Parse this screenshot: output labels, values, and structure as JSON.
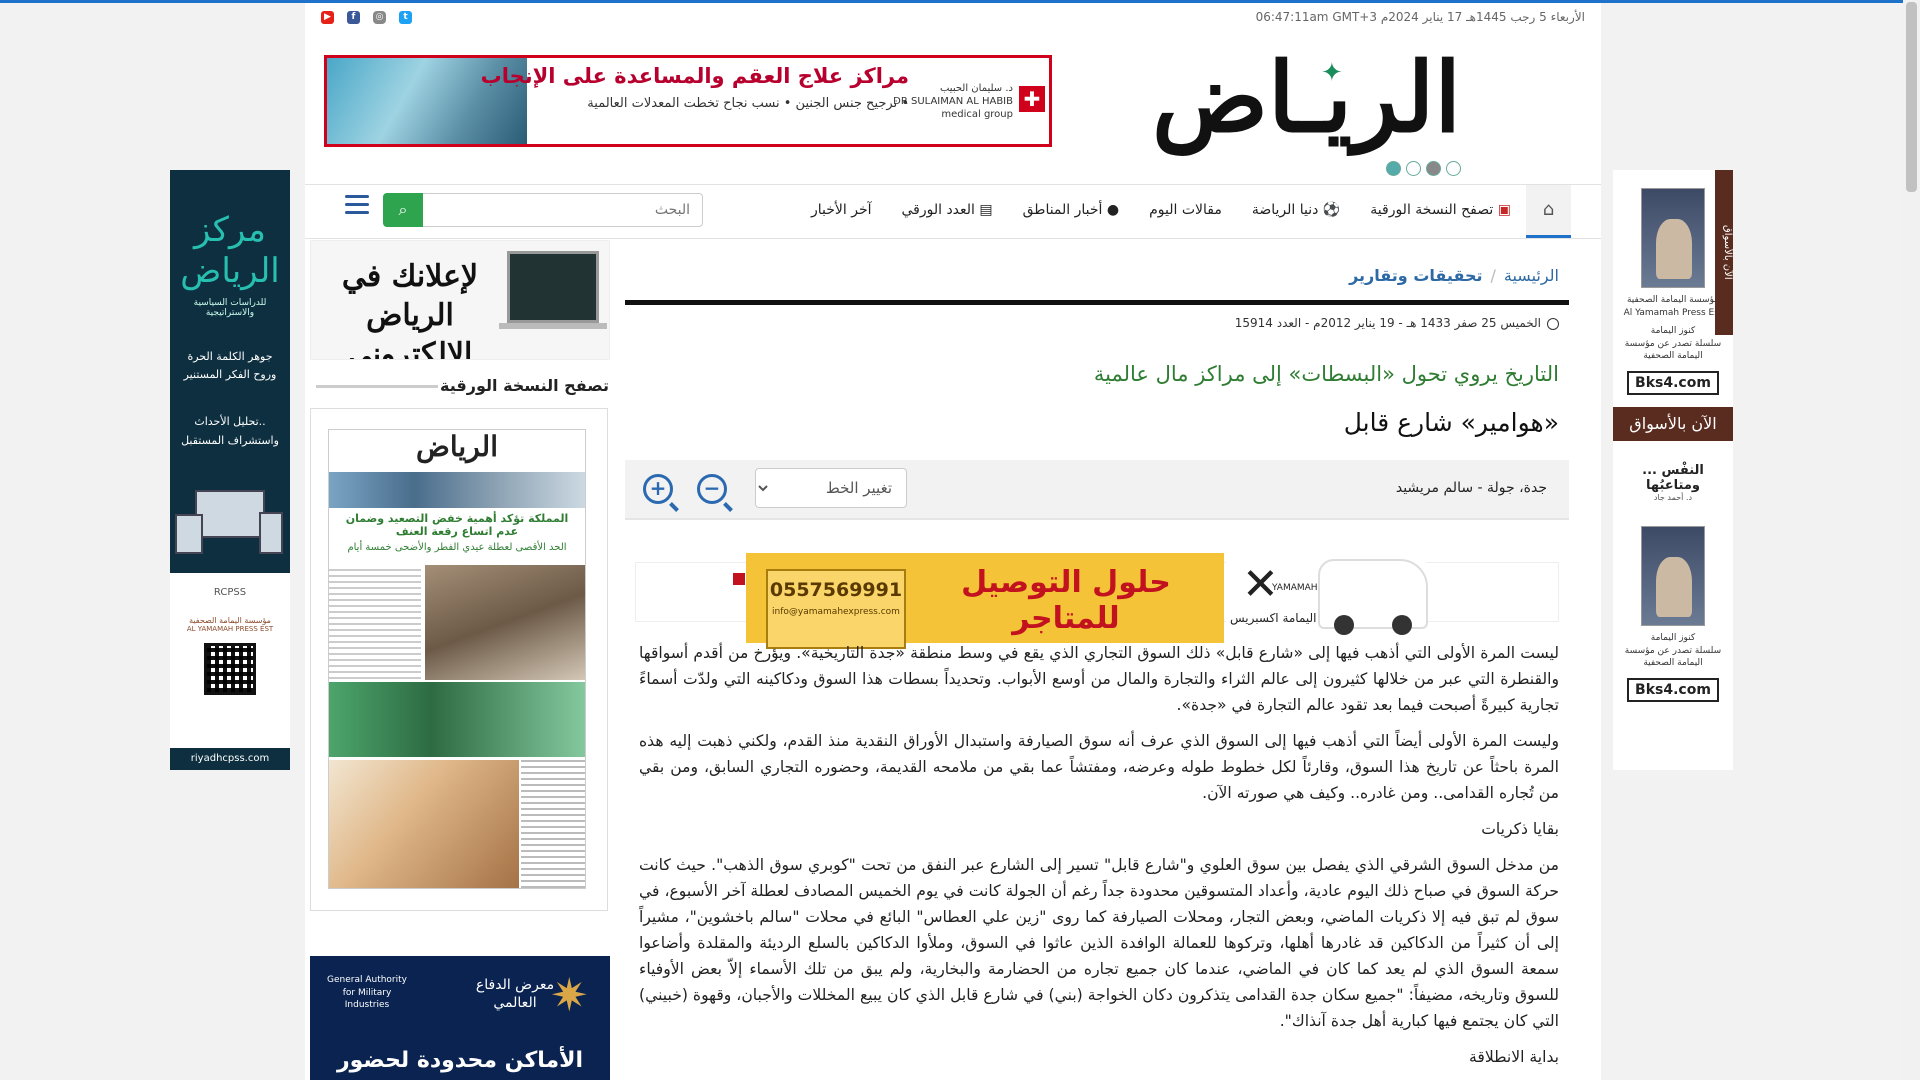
{
  "top_date": "الأربعاء 5 رجب 1445هـ 17 يناير 2024م 06:47:11am GMT+3",
  "social_icons": [
    "youtube-icon",
    "facebook-icon",
    "instagram-icon",
    "twitter-icon"
  ],
  "brand": {
    "name": "الريـاض"
  },
  "top_ad": {
    "title": "مراكز علاج العقم والمساعدة على الإنجاب",
    "bullets": "• ترجيح جنس الجنين   • نسب نجاح تخطت المعدلات العالمية",
    "sponsor_ar": "د. سليمان الحبيب",
    "sponsor_en": "DR SULAIMAN AL HABIB",
    "sponsor_sub": "medical group"
  },
  "nav": {
    "items": [
      "آخر الأخبار",
      "العدد الورقي",
      "أخبار المناطق",
      "مقالات اليوم",
      "دنيا الرياضة",
      "تصفح النسخة الورقية"
    ],
    "search_placeholder": "البحث"
  },
  "left_ad": {
    "logo": "مركز الرياض",
    "logo_sub": "للدراسات السياسية والاستراتيجية",
    "slogan1": "جوهر الكلمة الحرة",
    "slogan2": "وروح الفكر المستنير",
    "slogan3": "تحليل الأحداث..",
    "slogan4": "واستشراف المستقبل",
    "rcpss": "RCPSS",
    "yamama": "مؤسسة اليمامة الصحفية",
    "yamama_en": "AL YAMAMAH PRESS EST",
    "url": "riyadhcpss.com"
  },
  "right_ad": {
    "pub1": "مؤسسة اليمامة الصحفية",
    "pub1_en": "Al Yamamah Press Est",
    "kunooz": "كنوز اليمامة",
    "series": "سلسلة تصدر عن مؤسسة اليمامة الصحفية",
    "bks": "Bks4.com",
    "now": "الآن بالأسواق",
    "vertical": "الآن بالأسواق",
    "book2": "النفْس ... ومتاعبُها",
    "author2": "د. أحمد جاد"
  },
  "sidebar": {
    "ad_text": "لإعلانك في الرياض الالكتروني",
    "paper_title": "تصفح النسخة الورقية",
    "paper_mast": "الرياض",
    "paper_headline": "المملكة تؤكد أهمية خفض التصعيد وضمان عدم اتساع رقعة العنف",
    "paper_sub": "الحد الأقصى لعطلة عيدي الفطر والأضحى خمسة أيام",
    "bottom_ad_exhib": "معرض الدفاع العالمي",
    "bottom_ad_org": "General Authority for Military Industries",
    "bottom_ad_big": "الأماكن محدودة لحضور"
  },
  "article": {
    "breadcrumb": [
      "الرئيسية",
      "تحقيقات وتقارير"
    ],
    "meta": "الخميس 25 صفر 1433 هـ - 19 يناير 2012م - العدد 15914",
    "subtitle": "التاريخ يروي تحول «البسطات» إلى مراكز مال عالمية",
    "headline": "«هوامير» شارع قابل",
    "author": "جدة، جولة - سالم مريشيد",
    "font_select": "تغيير الخط",
    "ad": {
      "phone": "0557569991",
      "email": "info@yamamahexpress.com",
      "slogan": "حلول التوصيل للمتاجر",
      "brand": "YAMAMAH EXPRESS",
      "brand_ar": "اليمامة اكسبريس"
    },
    "paragraphs": [
      "ليست المرة الأولى التي أذهب فيها إلى «شارع قابل» ذلك السوق التجاري الذي يقع في وسط منطقة «جدة التاريخية». ويؤرخ من أقدم أسواقها والقنطرة التي عبر من خلالها كثيرون إلى عالم الثراء والتجارة والمال من أوسع الأبواب. وتحديداً بسطات هذا السوق ودكاكينه التي ولدّت أسماءً تجارية كبيرةً أصبحت فيما بعد تقود عالم التجارة في «جدة».",
      "وليست المرة الأولى أيضاً التي أذهب فيها إلى السوق الذي عرف أنه سوق الصيارفة واستبدال الأوراق النقدية منذ القدم، ولكني ذهبت إليه هذه المرة باحثاً عن تاريخ هذا السوق، وقارئاً لكل خطوط طوله وعرضه، ومفتشاً عما بقي من ملامحه القديمة، وحضوره التجاري السابق، ومن بقي من تُجاره القدامى.. ومن غادره.. وكيف هي صورته الآن.",
      "بقايا ذكريات",
      "من مدخل السوق الشرقي الذي يفصل بين سوق العلوي و\"شارع قابل\" تسير إلى الشارع عبر النفق من تحت \"كوبري سوق الذهب\". حيث كانت حركة السوق في صباح ذلك اليوم عادية، وأعداد المتسوقين محدودة جداً رغم أن الجولة كانت في يوم الخميس المصادف لعطلة آخر الأسبوع، في سوق لم تبق فيه إلا ذكريات الماضي، وبعض التجار، ومحلات الصيارفة كما روى \"زين علي العطاس\" البائع في محلات \"سالم باخشوين\"، مشيراً إلى أن كثيراً من الدكاكين قد غادرها أهلها، وتركوها للعمالة الوافدة الذين عاثوا في السوق، وملأوا الدكاكين بالسلع الرديئة والمقلدة وأضاعوا سمعة السوق الذي لم يعد كما كان في الماضي، عندما كان جميع تجاره من الحضارمة والبخارية، ولم يبق من تلك الأسماء إلاّ بعض الأوفياء للسوق وتاريخه، مضيفاً: \"جميع سكان جدة القدامى يتذكرون دكان الخواجة (بني) في شارع قابل الذي كان يبيع المخللات والأجبان، وقهوة (خبيني) التي كان يجتمع فيها كبارية أهل جدة آنذاك\".",
      "بداية الانطلاقة"
    ]
  }
}
